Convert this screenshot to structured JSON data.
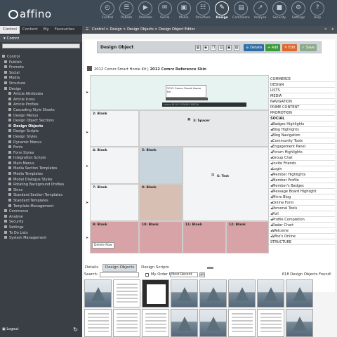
{
  "app": {
    "logo_text": "affino"
  },
  "nav": [
    {
      "label": "Control",
      "icon": "dashboard-icon"
    },
    {
      "label": "Publish",
      "icon": "document-icon"
    },
    {
      "label": "Promote",
      "icon": "megaphone-icon"
    },
    {
      "label": "Social",
      "icon": "chat-icon"
    },
    {
      "label": "Media",
      "icon": "image-icon"
    },
    {
      "label": "Structure",
      "icon": "structure-icon"
    },
    {
      "label": "Design",
      "icon": "palette-icon"
    },
    {
      "label": "Commerce",
      "icon": "cart-icon"
    },
    {
      "label": "Analyse",
      "icon": "chart-icon"
    },
    {
      "label": "Security",
      "icon": "lock-icon"
    },
    {
      "label": "Settings",
      "icon": "gear-icon"
    },
    {
      "label": "Help",
      "icon": "help-icon"
    }
  ],
  "sidebar": {
    "tabs": [
      "Control",
      "Content",
      "My",
      "Favourites"
    ],
    "context": "Comrz",
    "tree": [
      {
        "label": "Control",
        "level": 0
      },
      {
        "label": "Publish",
        "level": 1
      },
      {
        "label": "Promote",
        "level": 1
      },
      {
        "label": "Social",
        "level": 1
      },
      {
        "label": "Media",
        "level": 1
      },
      {
        "label": "Structure",
        "level": 1
      },
      {
        "label": "Design",
        "level": 1
      },
      {
        "label": "Article Attributes",
        "level": 2
      },
      {
        "label": "Article Icons",
        "level": 2
      },
      {
        "label": "Article Profiles",
        "level": 2
      },
      {
        "label": "Cascading Style Sheets",
        "level": 2
      },
      {
        "label": "Design Menus",
        "level": 2
      },
      {
        "label": "Design Object Sections",
        "level": 2
      },
      {
        "label": "Design Objects",
        "level": 2,
        "selected": true
      },
      {
        "label": "Design Scripts",
        "level": 2
      },
      {
        "label": "Design Styles",
        "level": 2
      },
      {
        "label": "Dynamic Menus",
        "level": 2
      },
      {
        "label": "Fonts",
        "level": 2
      },
      {
        "label": "Form Styles",
        "level": 2
      },
      {
        "label": "Integration Scripts",
        "level": 2
      },
      {
        "label": "Main Menus",
        "level": 2
      },
      {
        "label": "Media Section Templates",
        "level": 2
      },
      {
        "label": "Media Templates",
        "level": 2
      },
      {
        "label": "Modal Dialogue Styles",
        "level": 2
      },
      {
        "label": "Rotating Background Profiles",
        "level": 2
      },
      {
        "label": "Skins",
        "level": 2
      },
      {
        "label": "Standard Section Templates",
        "level": 2
      },
      {
        "label": "Standard Templates",
        "level": 2
      },
      {
        "label": "Template Management",
        "level": 2
      },
      {
        "label": "Commerce",
        "level": 1
      },
      {
        "label": "Analyse",
        "level": 1
      },
      {
        "label": "Security",
        "level": 1
      },
      {
        "label": "Settings",
        "level": 1
      },
      {
        "label": "To Do Lists",
        "level": 1
      },
      {
        "label": "System Management",
        "level": 1
      }
    ],
    "logout": "Logout"
  },
  "breadcrumb": "Control > Design > Design Objects > Design Object Editor",
  "panel": {
    "title": "Design Object",
    "buttons": {
      "details": "Details",
      "add": "Add",
      "edit": "Edit",
      "save": "Save"
    },
    "skin_label": "2012 Comrz Smart Home Kit",
    "skin_bold": "2012 Comrz Reference Skin"
  },
  "layout_cells": {
    "top": "2012 Comrz Smart Home Kit",
    "comrz_bar": "comrz  BLOG  FORUMS  MEDIA",
    "r2a": "2: Blank",
    "r2b": "3: Spacer",
    "r3a": "4: Blank",
    "r3b": "5: Blank",
    "r3c": "6: Text",
    "r4a": "7: Blank",
    "r4b": "8: Blank",
    "r5a": "9: Blank",
    "r5b": "10: Blank",
    "r5c": "11: Blank",
    "r5d": "12: Blank",
    "delete_row": "Delete Row"
  },
  "sidelist": [
    {
      "label": "COMMERCE",
      "type": "hd"
    },
    {
      "label": "DESIGN",
      "type": "hd"
    },
    {
      "label": "LISTS",
      "type": "hd"
    },
    {
      "label": "MEDIA",
      "type": "hd"
    },
    {
      "label": "NAVIGATION",
      "type": "hd"
    },
    {
      "label": "PRIME CONTENT",
      "type": "hd"
    },
    {
      "label": "PROMOTION",
      "type": "hd"
    },
    {
      "label": "SOCIAL",
      "type": "hd-b"
    },
    {
      "label": "Badges Highlights",
      "type": "sub"
    },
    {
      "label": "Blog Highlights",
      "type": "sub"
    },
    {
      "label": "Blog Navigation",
      "type": "sub"
    },
    {
      "label": "Community Tools",
      "type": "sub"
    },
    {
      "label": "Engagement Panel",
      "type": "sub"
    },
    {
      "label": "Forum Highlights",
      "type": "sub"
    },
    {
      "label": "Group Chat",
      "type": "sub"
    },
    {
      "label": "Invite Friends",
      "type": "sub"
    },
    {
      "label": "Login",
      "type": "sub"
    },
    {
      "label": "Member Highlights",
      "type": "sub"
    },
    {
      "label": "Member Profile",
      "type": "sub"
    },
    {
      "label": "Member's Badges",
      "type": "sub"
    },
    {
      "label": "Message Board Highlight",
      "type": "sub"
    },
    {
      "label": "Micro Blog",
      "type": "sub"
    },
    {
      "label": "Online Form",
      "type": "sub"
    },
    {
      "label": "Personal Tools",
      "type": "sub"
    },
    {
      "label": "Poll",
      "type": "sub"
    },
    {
      "label": "Profile Completion",
      "type": "sub"
    },
    {
      "label": "Radar Chart",
      "type": "sub"
    },
    {
      "label": "Welcome",
      "type": "sub"
    },
    {
      "label": "Who's Online",
      "type": "sub"
    },
    {
      "label": "STRUCTURE",
      "type": "hd"
    }
  ],
  "bottom": {
    "tabs": [
      "Details",
      "Design Objects",
      "Design Scripts"
    ],
    "search_label": "Search:",
    "order_label": "My Order By:",
    "order_value": "Most Recent",
    "go": "go",
    "found": "618 Design Objects Found!"
  },
  "colors": {
    "header": "#3e4a55",
    "sidebar": "#3a3f45",
    "details": "#2e6da4",
    "add": "#3c9a3c",
    "edit": "#e0662a",
    "save": "#8ba98b",
    "top_row": "#e7f3f1",
    "blue_cell": "#c8d5dd",
    "tan_cell": "#d8bfb4",
    "red_row": "#d7a3a6"
  }
}
